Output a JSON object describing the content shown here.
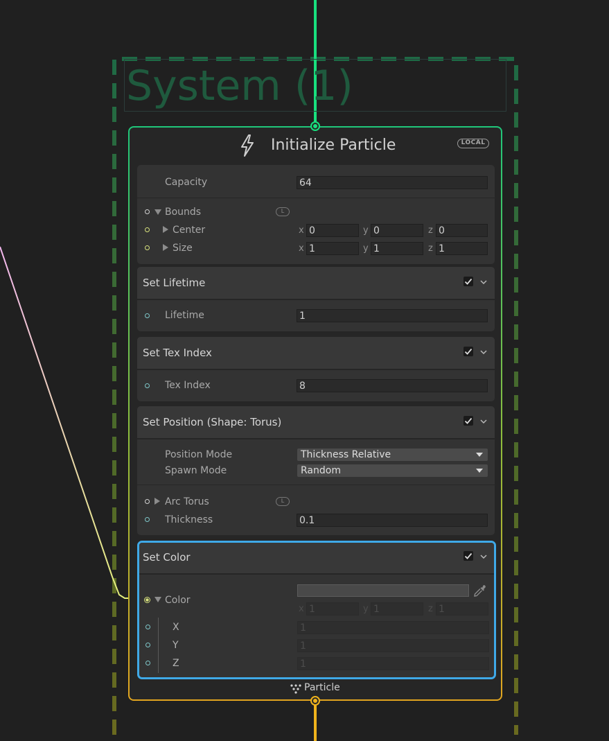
{
  "system": {
    "title": "System (1)"
  },
  "context": {
    "title": "Initialize Particle",
    "space_badge": "LOCAL",
    "capacity": {
      "label": "Capacity",
      "value": "64"
    },
    "bounds": {
      "label": "Bounds",
      "badge": "L",
      "center": {
        "label": "Center",
        "x": "0",
        "y": "0",
        "z": "0"
      },
      "size": {
        "label": "Size",
        "x": "1",
        "y": "1",
        "z": "1"
      }
    },
    "output_label": "Particle"
  },
  "axes": {
    "x": "x",
    "y": "y",
    "z": "z"
  },
  "blocks": {
    "set_lifetime": {
      "title": "Set Lifetime",
      "enabled": true,
      "field_label": "Lifetime",
      "value": "1"
    },
    "set_tex_index": {
      "title": "Set Tex Index",
      "enabled": true,
      "field_label": "Tex Index",
      "value": "8"
    },
    "set_position": {
      "title": "Set Position (Shape: Torus)",
      "enabled": true,
      "position_mode": {
        "label": "Position Mode",
        "value": "Thickness Relative"
      },
      "spawn_mode": {
        "label": "Spawn Mode",
        "value": "Random"
      },
      "arc_torus": {
        "label": "Arc Torus",
        "badge": "L"
      },
      "thickness": {
        "label": "Thickness",
        "value": "0.1"
      }
    },
    "set_color": {
      "title": "Set Color",
      "enabled": true,
      "selected": true,
      "color_label": "Color",
      "x": "1",
      "y": "1",
      "z": "1",
      "sub_x": {
        "label": "X",
        "value": "1"
      },
      "sub_y": {
        "label": "Y",
        "value": "1"
      },
      "sub_z": {
        "label": "Z",
        "value": "1"
      }
    }
  },
  "colors": {
    "background": "#202020",
    "system_border": "#1e6a45",
    "flow_in": "#18e07e",
    "flow_out": "#f0b31c",
    "selection": "#3fa9e8",
    "edge_start": "#f3b7ee",
    "edge_end": "#e4ef7d"
  }
}
